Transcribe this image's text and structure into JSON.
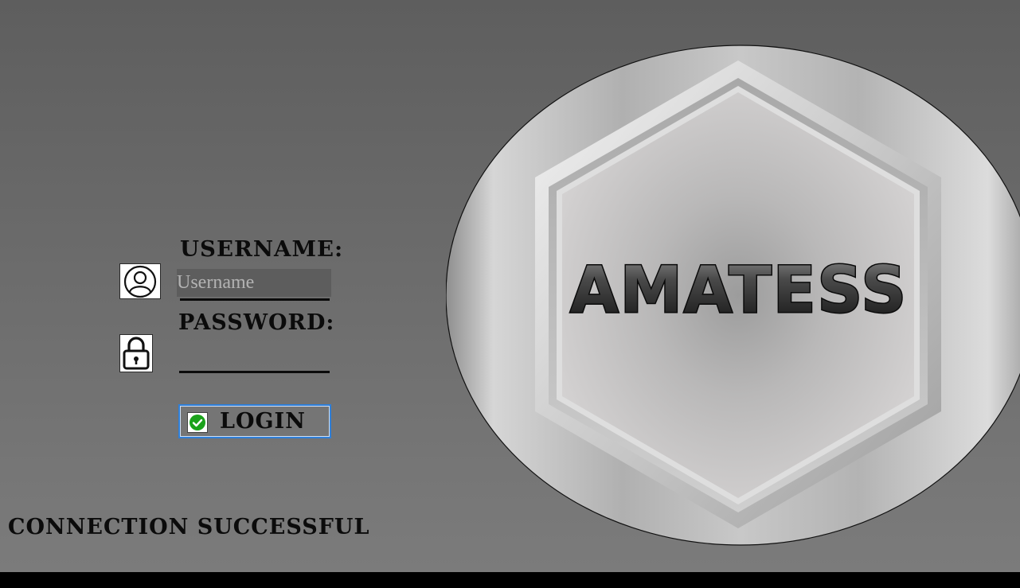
{
  "login_form": {
    "username_label": "USERNAME:",
    "username_placeholder": "Username",
    "username_value": "",
    "password_label": "PASSWORD:",
    "password_value": "",
    "login_button_label": "LOGIN"
  },
  "status": {
    "message": "CONNECTION SUCCESSFUL"
  },
  "logo": {
    "brand_name": "AMATESS"
  },
  "icons": {
    "user": "user-icon",
    "lock": "lock-icon",
    "login": "check-circle-icon"
  },
  "colors": {
    "background": "#6a6a6a",
    "text": "#0b0b0b",
    "button_border": "#2f7fd8",
    "check_green": "#1ba21b",
    "bottom_bar": "#000000"
  }
}
